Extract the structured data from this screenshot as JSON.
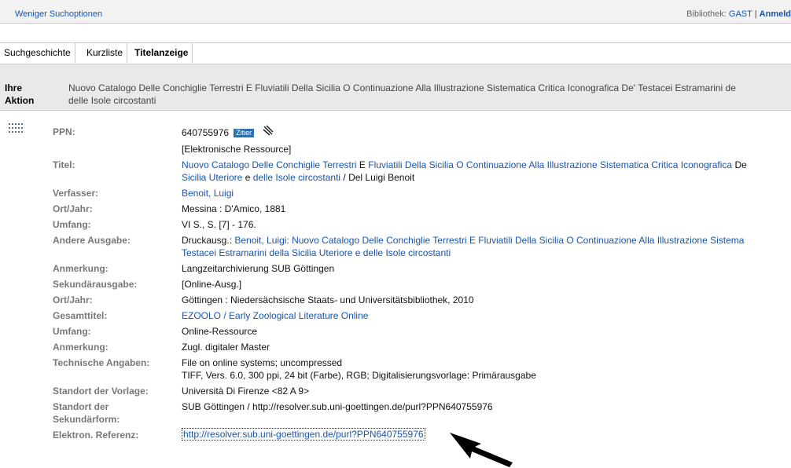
{
  "topbar": {
    "fewer_options": "Weniger Suchoptionen",
    "library_label": "Bibliothek:",
    "library_value": "GAST",
    "separator": "|",
    "login": "Anmeld"
  },
  "tabs": [
    {
      "label": "Suchgeschichte"
    },
    {
      "label": "Kurzliste"
    },
    {
      "label": "Titelanzeige",
      "active": true
    }
  ],
  "action": {
    "label_line1": "Ihre",
    "label_line2": "Aktion",
    "title_line1": "Nuovo Catalogo Delle Conchiglie Terrestri E Fluviatili Della Sicilia O Continuazione Alla Illustrazione Sistematica Critica Iconografica De' Testacei Estramarini de",
    "title_line2": "delle Isole circostanti"
  },
  "record": {
    "ppn_label": "PPN:",
    "ppn_value": "640755976",
    "cite_badge": "Zitier",
    "ppn_type": "[Elektronische Ressource]",
    "titel_label": "Titel:",
    "titel_link1": "Nuovo Catalogo Delle Conchiglie Terrestri",
    "titel_text1": " E ",
    "titel_link2": "Fluviatili Della Sicilia O Continuazione Alla Illustrazione Sistematica Critica Iconografica",
    "titel_text2": " De",
    "titel_link3": "Sicilia Uteriore",
    "titel_text3": " e ",
    "titel_link4": "delle Isole circostanti",
    "titel_text4": " / Del Luigi Benoit",
    "verfasser_label": "Verfasser:",
    "verfasser_value": "Benoit, Luigi",
    "ortjahr_label": "Ort/Jahr:",
    "ortjahr_value": "Messina : D'Amico, 1881",
    "umfang_label": "Umfang:",
    "umfang_value": "VI S., S. [7] - 176.",
    "andere_label": "Andere Ausgabe:",
    "andere_prefix": "Druckausg.: ",
    "andere_link1": "Benoit, Luigi: Nuovo Catalogo Delle Conchiglie Terrestri E Fluviatili Della Sicilia O Continuazione Alla Illustrazione Sistema",
    "andere_link2": "Testacei Estramarini della Sicilia Uteriore e delle Isole circostanti",
    "anmerkung1_label": "Anmerkung:",
    "anmerkung1_value": "Langzeitarchivierung SUB Göttingen",
    "sekundar_label": "Sekundärausgabe:",
    "sekundar_value": "[Online-Ausg.]",
    "ortjahr2_label": "Ort/Jahr:",
    "ortjahr2_value": "Göttingen : Niedersächsische Staats- und Universitätsbibliothek, 2010",
    "gesamt_label": "Gesamttitel:",
    "gesamt_value": "EZOOLO / Early Zoological Literature Online",
    "umfang2_label": "Umfang:",
    "umfang2_value": "Online-Ressource",
    "anmerkung2_label": "Anmerkung:",
    "anmerkung2_value": "Zugl. digitaler Master",
    "tech_label": "Technische Angaben:",
    "tech_value1": "File on online systems; uncompressed",
    "tech_value2": "TIFF, Vers. 6.0, 300 ppi, 24 bit (Farbe), RGB; Digitalisierungsvorlage: Primärausgabe",
    "standort_vorlage_label": "Standort der Vorlage:",
    "standort_vorlage_value": "Università Di Firenze <82 A 9>",
    "standort_sek_label1": "Standort der",
    "standort_sek_label2": "Sekundärform:",
    "standort_sek_value": "SUB Göttingen / http://resolver.sub.uni-goettingen.de/purl?PPN640755976",
    "elref_label": "Elektron. Referenz:",
    "elref_value": "http://resolver.sub.uni-goettingen.de/purl?PPN640755976"
  },
  "icons": {
    "record_icon": "record-grid-icon",
    "arrow": "pointer-arrow-icon"
  },
  "colors": {
    "link": "#1a55a8",
    "label": "#777777",
    "bar": "#e9e9e9",
    "badge": "#2d6fb0"
  }
}
